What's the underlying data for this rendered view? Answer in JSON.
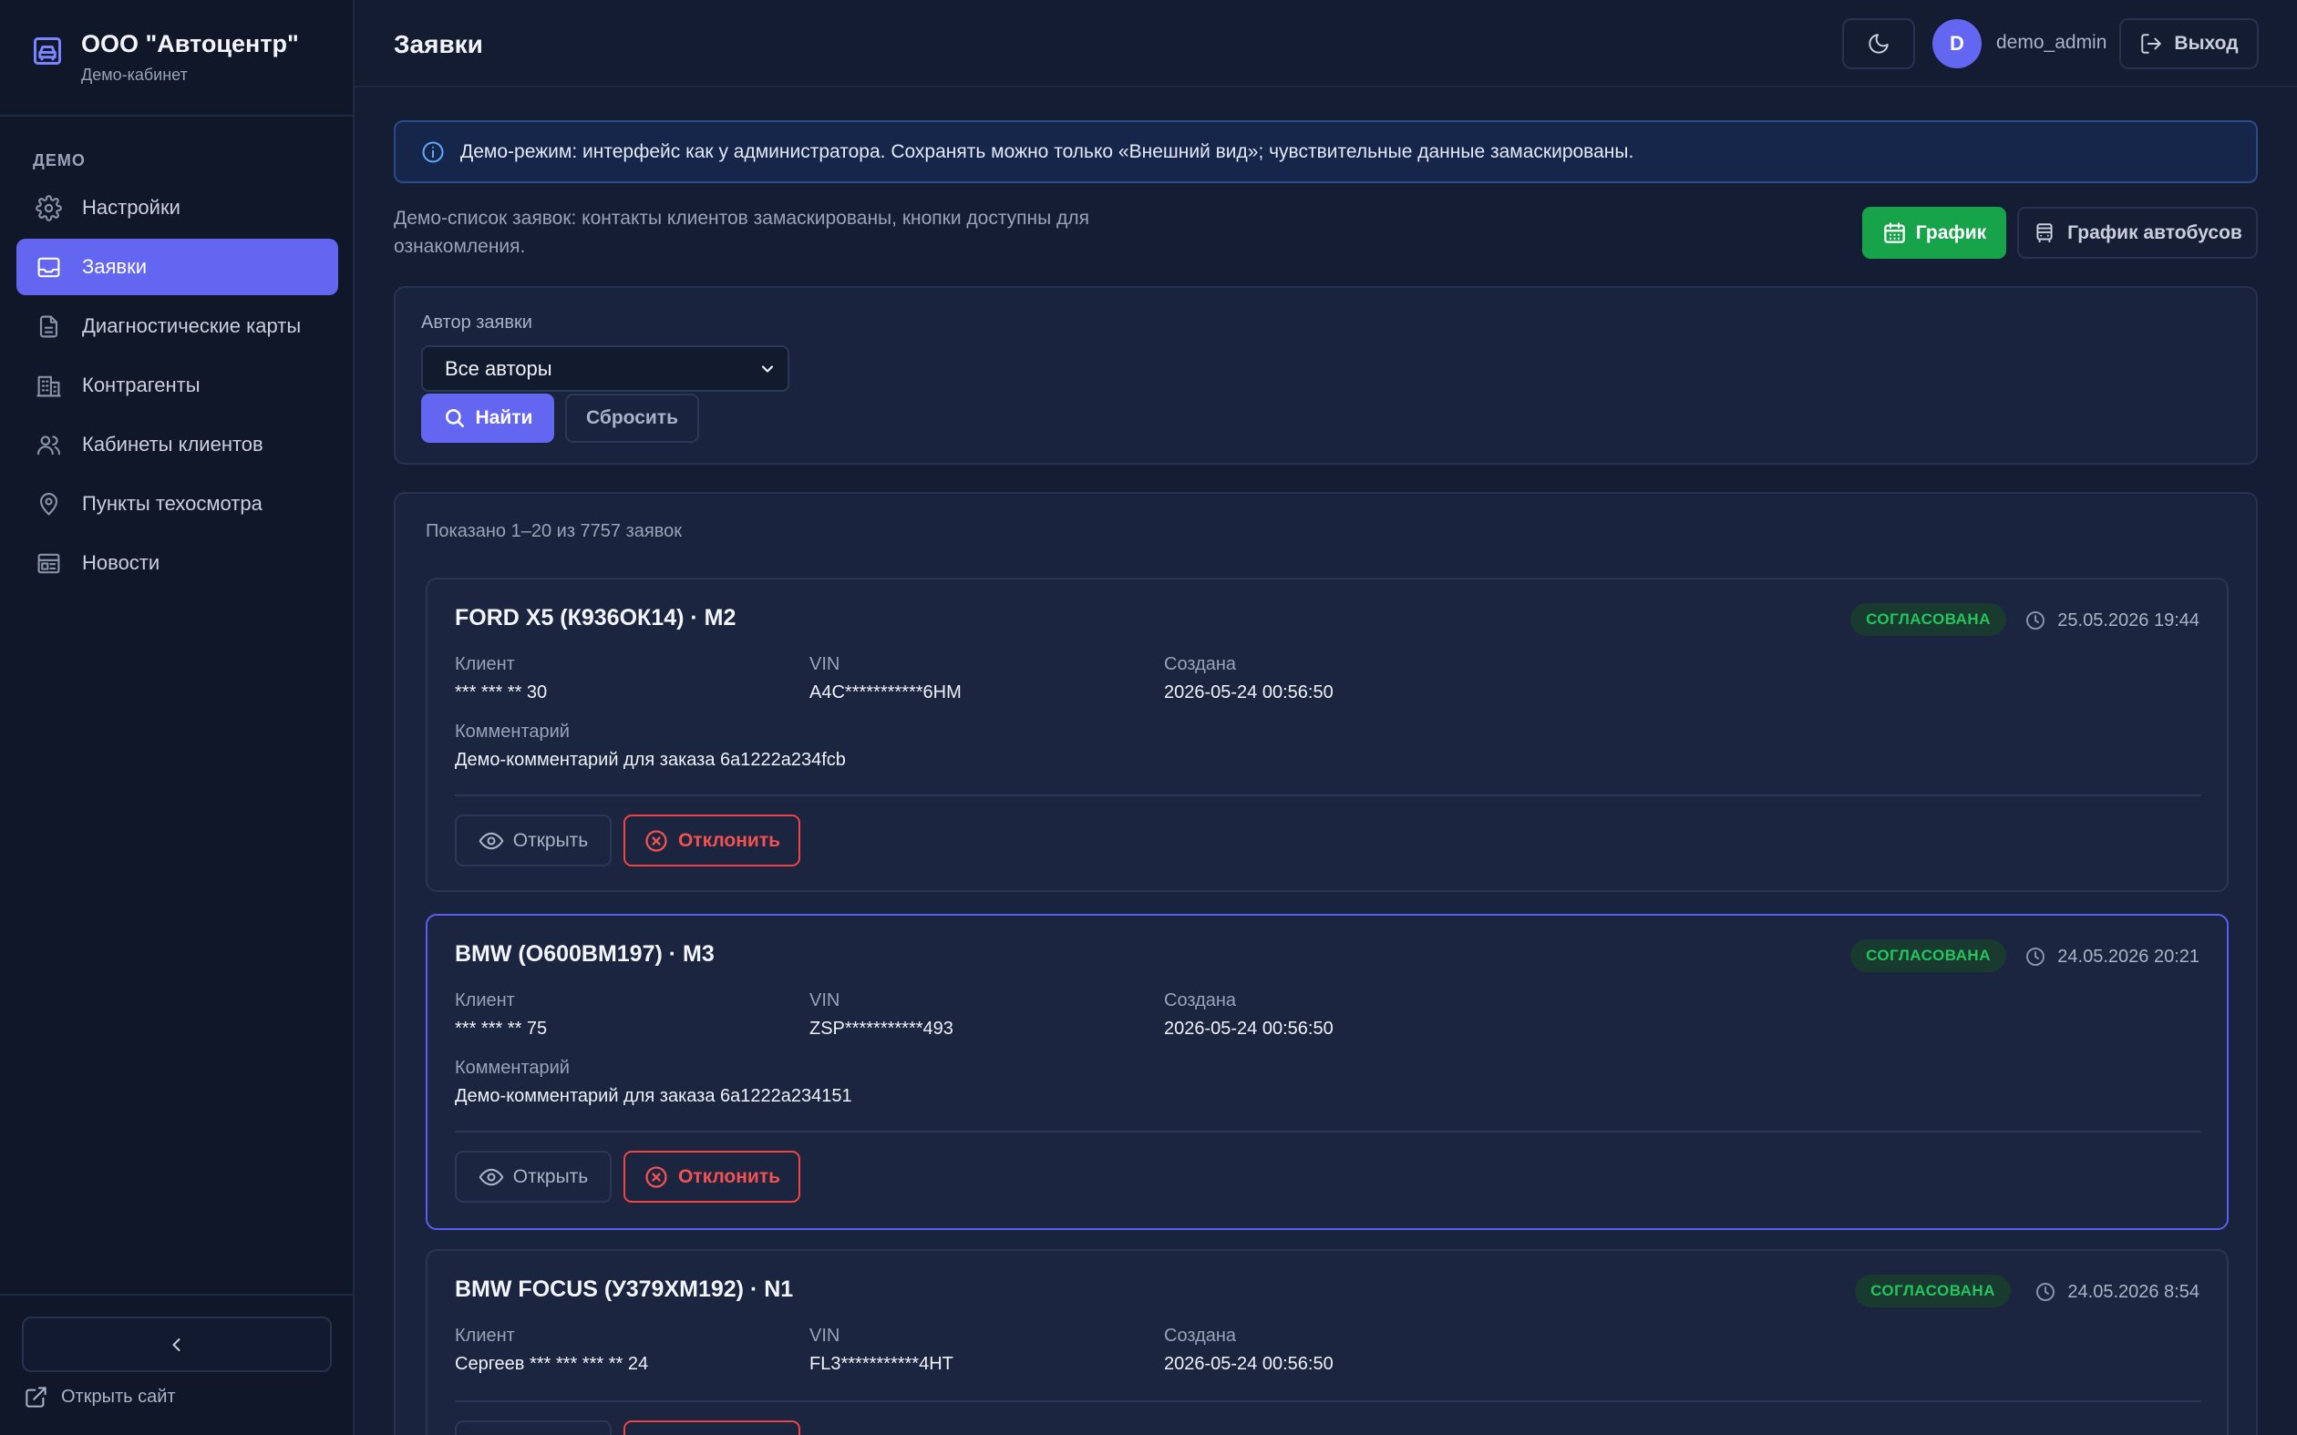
{
  "sidebar": {
    "brand_title": "ООО \"Автоцентр\"",
    "brand_sub": "Демо-кабинет",
    "section": "ДЕМО",
    "items": [
      {
        "label": "Настройки",
        "icon": "gear-icon"
      },
      {
        "label": "Заявки",
        "icon": "inbox-icon",
        "active": true
      },
      {
        "label": "Диагностические карты",
        "icon": "document-icon"
      },
      {
        "label": "Контрагенты",
        "icon": "building-icon"
      },
      {
        "label": "Кабинеты клиентов",
        "icon": "users-icon"
      },
      {
        "label": "Пункты техосмотра",
        "icon": "map-pin-icon"
      },
      {
        "label": "Новости",
        "icon": "newspaper-icon"
      }
    ],
    "open_site": "Открыть сайт"
  },
  "header": {
    "title": "Заявки",
    "avatar_letter": "D",
    "username": "demo_admin",
    "logout": "Выход"
  },
  "alert": "Демо-режим: интерфейс как у администратора. Сохранять можно только «Внешний вид»; чувствительные данные замаскированы.",
  "description": "Демо-список заявок: контакты клиентов замаскированы, кнопки доступны для ознакомления.",
  "actions": {
    "graph": "График",
    "bus_graph": "График автобусов"
  },
  "filter": {
    "label": "Автор заявки",
    "selected": "Все авторы",
    "find": "Найти",
    "reset": "Сбросить"
  },
  "list": {
    "shown": "Показано 1–20 из 7757 заявок",
    "labels": {
      "client": "Клиент",
      "vin": "VIN",
      "created": "Создана",
      "comment": "Комментарий",
      "open": "Открыть",
      "reject": "Отклонить"
    },
    "cards": [
      {
        "title": "FORD X5 (К936ОК14) · M2",
        "status": "СОГЛАСОВАНА",
        "date": "25.05.2026 19:44",
        "client": "*** *** ** 30",
        "vin": "A4C***********6HM",
        "created": "2026-05-24 00:56:50",
        "comment": "Демо-комментарий для заказа 6a1222a234fcb"
      },
      {
        "title": "BMW (О600ВМ197) · M3",
        "status": "СОГЛАСОВАНА",
        "date": "24.05.2026 20:21",
        "client": "*** *** ** 75",
        "vin": "ZSP***********493",
        "created": "2026-05-24 00:56:50",
        "comment": "Демо-комментарий для заказа 6a1222a234151"
      },
      {
        "title": "BMW FOCUS (У379ХМ192) · N1",
        "status": "СОГЛАСОВАНА",
        "date": "24.05.2026 8:54",
        "client": "Сергеев *** *** *** ** 24",
        "vin": "FL3***********4HT",
        "created": "2026-05-24 00:56:50"
      }
    ]
  },
  "colors": {
    "accent": "#6366f1",
    "success": "#16a34a",
    "danger": "#ef4444"
  }
}
